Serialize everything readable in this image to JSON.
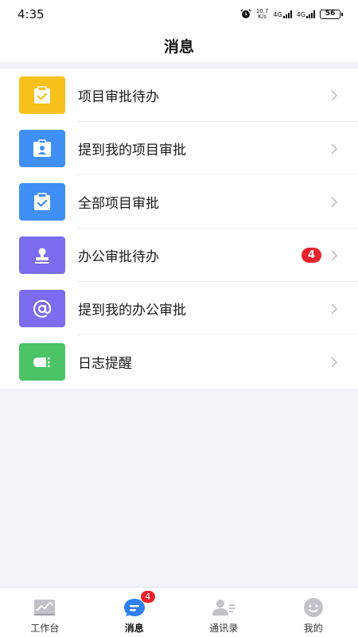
{
  "status_bar": {
    "time": "4:35",
    "net_speed_value": "10.7",
    "net_speed_unit": "K/s",
    "network_1": "4G",
    "network_2": "4G",
    "battery": "56"
  },
  "header": {
    "title": "消息"
  },
  "list": {
    "items": [
      {
        "label": "项目审批待办",
        "icon": "clipboard-check-icon",
        "color": "#f7c01b",
        "badge": ""
      },
      {
        "label": "提到我的项目审批",
        "icon": "id-badge-icon",
        "color": "#3f8ff5",
        "badge": ""
      },
      {
        "label": "全部项目审批",
        "icon": "clipboard-check-icon",
        "color": "#3f8ff5",
        "badge": ""
      },
      {
        "label": "办公审批待办",
        "icon": "stamp-icon",
        "color": "#7b6cf0",
        "badge": "4"
      },
      {
        "label": "提到我的办公审批",
        "icon": "at-sign-icon",
        "color": "#7b6cf0",
        "badge": ""
      },
      {
        "label": "日志提醒",
        "icon": "bell-icon",
        "color": "#4cc364",
        "badge": ""
      }
    ]
  },
  "tab_bar": {
    "tabs": [
      {
        "label": "工作台",
        "icon": "chart-icon",
        "active": false
      },
      {
        "label": "消息",
        "icon": "message-icon",
        "active": true,
        "badge": "4"
      },
      {
        "label": "通讯录",
        "icon": "contacts-icon",
        "active": false
      },
      {
        "label": "我的",
        "icon": "profile-icon",
        "active": false
      }
    ]
  },
  "colors": {
    "accent": "#3f8ff5",
    "badge": "#e8232b",
    "background": "#f2f3f7"
  }
}
